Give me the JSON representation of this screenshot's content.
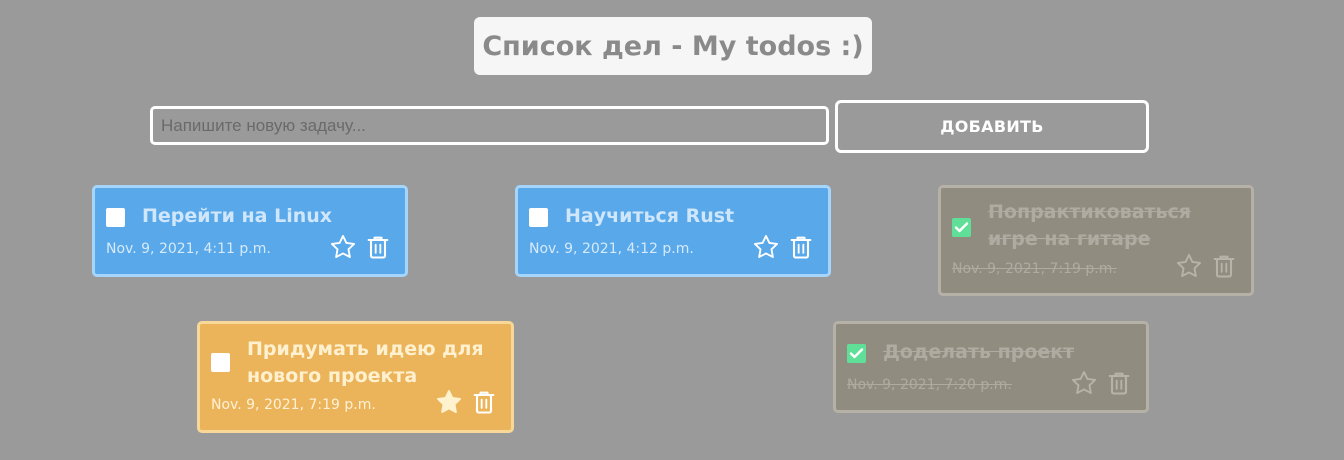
{
  "header": {
    "title": "Список дел - My todos :)"
  },
  "form": {
    "input_value": "",
    "input_placeholder": "Напишите новую задачу...",
    "add_label": "ДОБАВИТЬ"
  },
  "colors": {
    "background": "#9a9a9a",
    "card_blue": "#58a8ea",
    "card_orange": "#ebb45a",
    "card_done": "#918c80",
    "checkbox_checked": "#5fdf98"
  },
  "todos": [
    {
      "title": "Перейти на Linux",
      "date": "Nov. 9, 2021, 4:11 p.m.",
      "done": false,
      "favorite": false,
      "color": "blue"
    },
    {
      "title": "Научиться Rust",
      "date": "Nov. 9, 2021, 4:12 p.m.",
      "done": false,
      "favorite": false,
      "color": "blue"
    },
    {
      "title": "Попрактиковаться игре на гитаре",
      "date": "Nov. 9, 2021, 7:19 p.m.",
      "done": true,
      "favorite": false,
      "color": "done"
    },
    {
      "title": "Придумать идею для нового проекта",
      "date": "Nov. 9, 2021, 7:19 p.m.",
      "done": false,
      "favorite": true,
      "color": "orange"
    },
    {
      "title": "Доделать проект",
      "date": "Nov. 9, 2021, 7:20 p.m.",
      "done": true,
      "favorite": false,
      "color": "done"
    }
  ],
  "icons": {
    "checkbox": "checkbox-icon",
    "check": "checkmark-icon",
    "favorite": "star-icon",
    "delete": "trash-icon"
  }
}
